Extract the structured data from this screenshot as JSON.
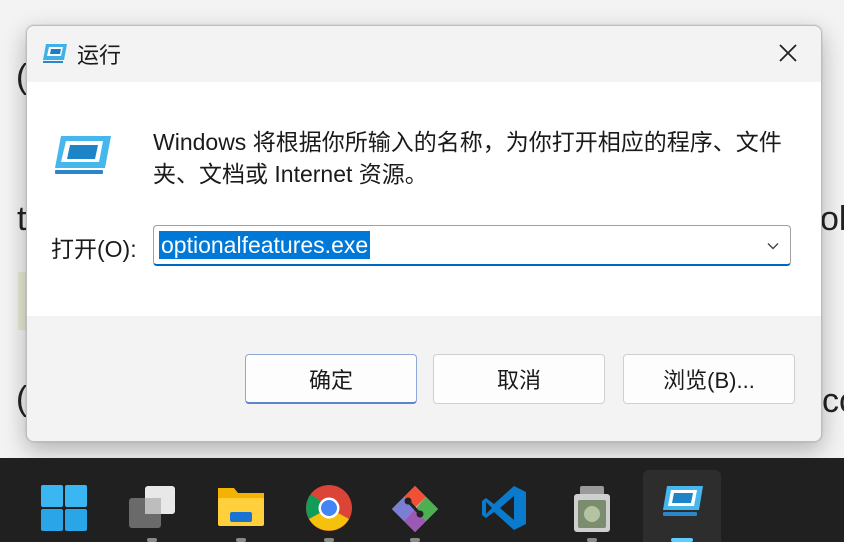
{
  "dialog": {
    "title": "运行",
    "message": "Windows 将根据你所输入的名称，为你打开相应的程序、文件夹、文档或 Internet 资源。",
    "open_label": "打开(O):",
    "input_value": "optionalfeatures.exe",
    "buttons": {
      "ok": "确定",
      "cancel": "取消",
      "browse": "浏览(B)..."
    }
  },
  "background_text": {
    "left_1": "(",
    "left_2": "t",
    "left_3": "(",
    "right_1": "ol",
    "right_2": "cc"
  },
  "taskbar": {
    "items": [
      {
        "icon": "windows-start-icon"
      },
      {
        "icon": "task-view-icon"
      },
      {
        "icon": "file-explorer-icon"
      },
      {
        "icon": "chrome-icon"
      },
      {
        "icon": "git-icon"
      },
      {
        "icon": "vscode-icon"
      },
      {
        "icon": "app-icon"
      },
      {
        "icon": "run-dialog-icon"
      }
    ]
  },
  "colors": {
    "accent": "#0078d7",
    "taskbar": "#202020",
    "active_indicator": "#60cdff"
  }
}
